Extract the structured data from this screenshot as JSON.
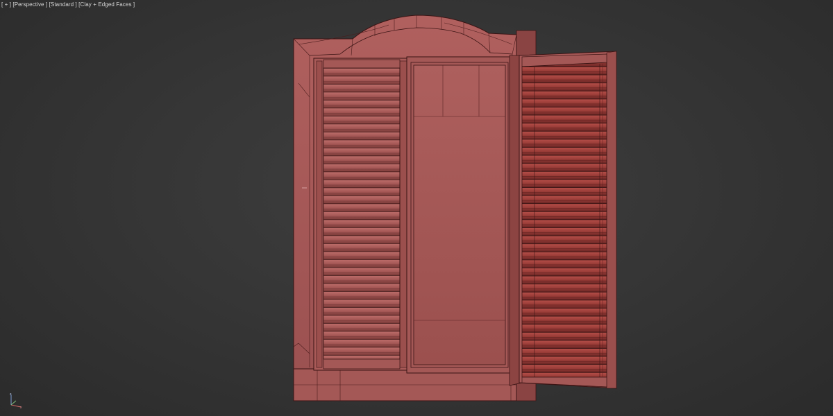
{
  "viewport": {
    "labels": [
      "[ + ]",
      "[Perspective ]",
      "[Standard ]",
      "[Clay + Edged Faces ]"
    ]
  },
  "scene": {
    "object": "window-with-louvered-shutters",
    "clay_color": "#a85a58",
    "edge_color": "#3a1414",
    "background_color": "#363636"
  },
  "gizmo": {
    "icon": "axis-tripod-icon"
  }
}
